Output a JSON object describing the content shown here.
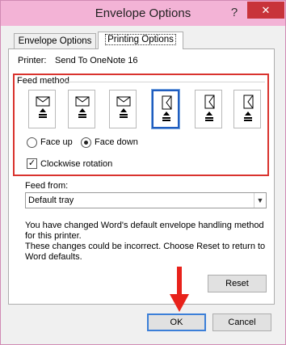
{
  "window": {
    "title": "Envelope Options",
    "help_glyph": "?",
    "close_glyph": "✕"
  },
  "tabs": [
    {
      "label": "Envelope Options",
      "accel": "E",
      "active": false
    },
    {
      "label": "Printing Options",
      "accel": "P",
      "active": true
    }
  ],
  "printer": {
    "label": "Printer:",
    "value": "Send To OneNote 16"
  },
  "feed_method": {
    "title": "Feed method",
    "selected_index": 3,
    "options_icons": [
      "feed-horizontal-left-icon",
      "feed-horizontal-center-icon",
      "feed-horizontal-right-icon",
      "feed-vertical-left-icon",
      "feed-vertical-center-icon",
      "feed-vertical-right-icon"
    ]
  },
  "face": {
    "up_label": "Face up",
    "down_label": "Face down",
    "selected": "down"
  },
  "clockwise": {
    "label": "Clockwise rotation",
    "checked": true
  },
  "feed_from": {
    "label": "Feed from:",
    "value": "Default tray"
  },
  "info": {
    "line1": "You have changed Word's default envelope handling method for this printer.",
    "line2": "These changes could be incorrect. Choose Reset to return to Word defaults."
  },
  "buttons": {
    "reset": "Reset",
    "ok": "OK",
    "cancel": "Cancel"
  },
  "colors": {
    "titlebar": "#f3b3d6",
    "highlight_box": "#d9332e",
    "selected_feed": "#1f5dbf",
    "arrow": "#e8221b"
  }
}
